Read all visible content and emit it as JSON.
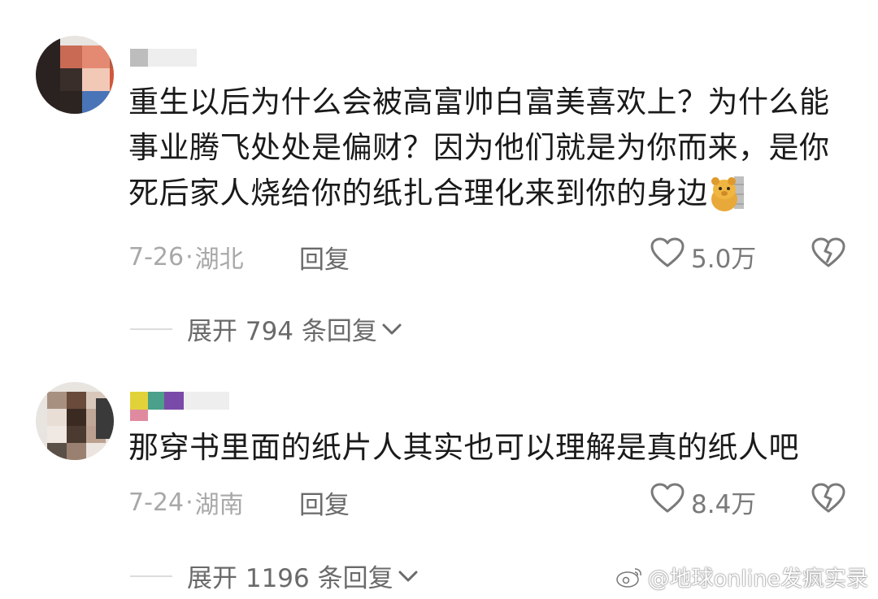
{
  "comments": [
    {
      "text_lines": [
        "重生以后为什么会被高富帅白富美喜欢上？为什么能",
        "事业腾飞处处是偏财？因为他们就是为你而来，是你",
        "死后家人烧给你的纸扎合理化来到你的身边"
      ],
      "emoji": "bear-emoji",
      "date": "7-26",
      "location": "湖北",
      "reply_label": "回复",
      "like_count": "5.0万",
      "expand_label": "展开 794 条回复"
    },
    {
      "text_lines": [
        "那穿书里面的纸片人其实也可以理解是真的纸人吧"
      ],
      "date": "7-24",
      "location": "湖南",
      "reply_label": "回复",
      "like_count": "8.4万",
      "expand_label": "展开 1196 条回复"
    }
  ],
  "separator": "·",
  "watermark": "@地球online发疯实录",
  "icons": {
    "like": "heart-outline-icon",
    "dislike": "broken-heart-icon",
    "expand": "chevron-down-icon",
    "watermark": "weibo-logo-icon"
  },
  "colors": {
    "text": "#1a1a1a",
    "meta": "#a8a8a8",
    "action": "#6a6a6a"
  }
}
